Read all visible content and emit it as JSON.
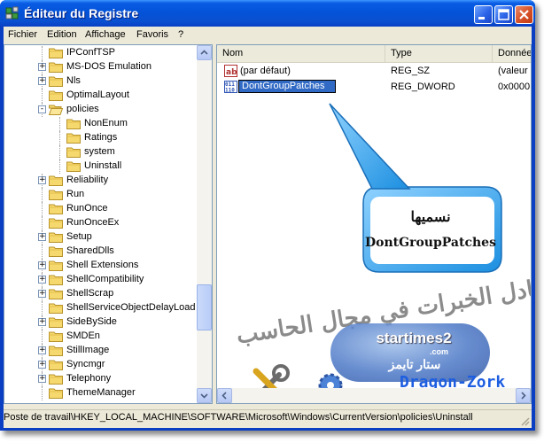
{
  "window": {
    "title": "Éditeur du Registre",
    "colors": {
      "titlebar": "#0453d9",
      "selection": "#316ac5",
      "client": "#ece9d8"
    }
  },
  "menu": [
    "Fichier",
    "Edition",
    "Affichage",
    "Favoris",
    "?"
  ],
  "tree": {
    "items": [
      {
        "label": "IPConfTSP",
        "expander": "",
        "depth": 0
      },
      {
        "label": "MS-DOS Emulation",
        "expander": "+",
        "depth": 0
      },
      {
        "label": "Nls",
        "expander": "+",
        "depth": 0
      },
      {
        "label": "OptimalLayout",
        "expander": "",
        "depth": 0
      },
      {
        "label": "policies",
        "expander": "-",
        "depth": 0
      },
      {
        "label": "NonEnum",
        "expander": "",
        "depth": 1
      },
      {
        "label": "Ratings",
        "expander": "",
        "depth": 1
      },
      {
        "label": "system",
        "expander": "",
        "depth": 1
      },
      {
        "label": "Uninstall",
        "expander": "",
        "depth": 1
      },
      {
        "label": "Reliability",
        "expander": "+",
        "depth": 0
      },
      {
        "label": "Run",
        "expander": "",
        "depth": 0
      },
      {
        "label": "RunOnce",
        "expander": "",
        "depth": 0
      },
      {
        "label": "RunOnceEx",
        "expander": "",
        "depth": 0
      },
      {
        "label": "Setup",
        "expander": "+",
        "depth": 0
      },
      {
        "label": "SharedDlls",
        "expander": "",
        "depth": 0
      },
      {
        "label": "Shell Extensions",
        "expander": "+",
        "depth": 0
      },
      {
        "label": "ShellCompatibility",
        "expander": "+",
        "depth": 0
      },
      {
        "label": "ShellScrap",
        "expander": "+",
        "depth": 0
      },
      {
        "label": "ShellServiceObjectDelayLoad",
        "expander": "",
        "depth": 0
      },
      {
        "label": "SideBySide",
        "expander": "+",
        "depth": 0
      },
      {
        "label": "SMDEn",
        "expander": "",
        "depth": 0
      },
      {
        "label": "StillImage",
        "expander": "+",
        "depth": 0
      },
      {
        "label": "Syncmgr",
        "expander": "+",
        "depth": 0
      },
      {
        "label": "Telephony",
        "expander": "+",
        "depth": 0
      },
      {
        "label": "ThemeManager",
        "expander": "",
        "depth": 0
      }
    ]
  },
  "list": {
    "columns": [
      "Nom",
      "Type",
      "Donnée"
    ],
    "rows": [
      {
        "icon": "string-value-icon",
        "name": "(par défaut)",
        "type": "REG_SZ",
        "data": "(valeur"
      },
      {
        "icon": "dword-value-icon",
        "name": "DontGroupPatches",
        "type": "REG_DWORD",
        "data": "0x0000"
      }
    ]
  },
  "callout": {
    "title": "نسميها",
    "key": "DontGroupPatches"
  },
  "watermark": {
    "arabic": "تبادل الخبرات في مجال الحاسب",
    "site": "startimes2",
    "com": ".com",
    "arabic_site": "ستار تايمز"
  },
  "signature": "Dragon-Zork",
  "status": {
    "path": "Poste de travail\\HKEY_LOCAL_MACHINE\\SOFTWARE\\Microsoft\\Windows\\CurrentVersion\\policies\\Uninstall"
  }
}
